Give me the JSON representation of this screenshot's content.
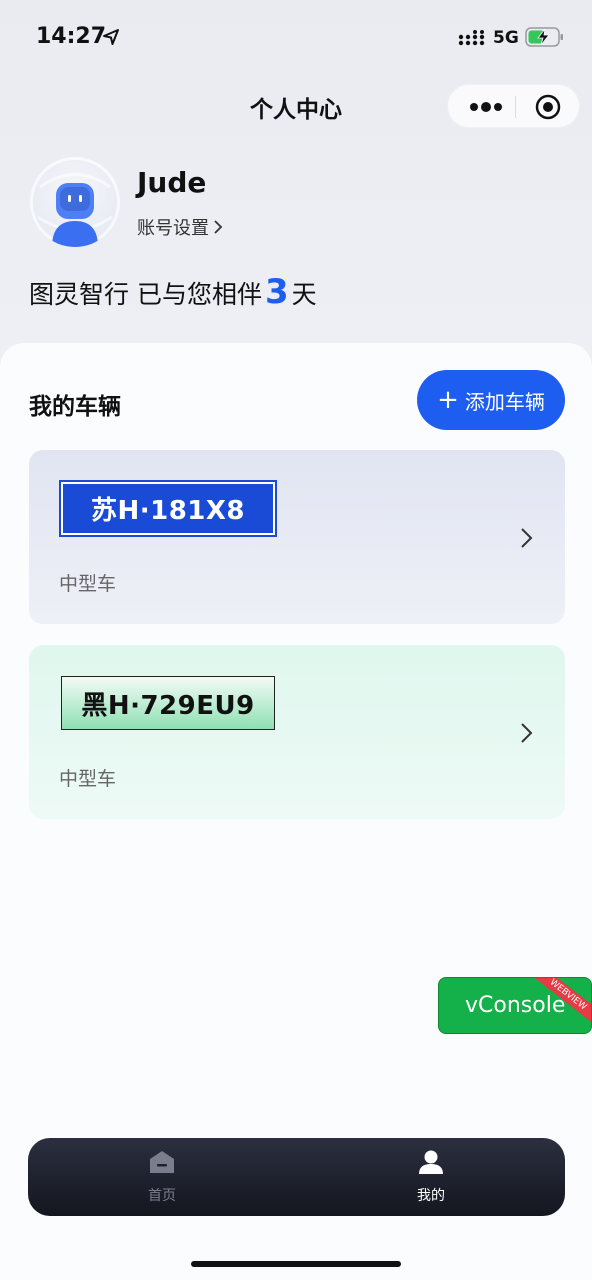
{
  "status_bar": {
    "time": "14:27",
    "network": "5G"
  },
  "nav": {
    "title": "个人中心"
  },
  "profile": {
    "username": "Jude",
    "account_settings": "账号设置",
    "companion_prefix": "图灵智行 已与您相伴",
    "companion_days": "3",
    "companion_suffix": "天"
  },
  "vehicles_section": {
    "title": "我的车辆",
    "add_button": "添加车辆",
    "vehicles": [
      {
        "plate": "苏H·181X8",
        "type": "中型车",
        "plate_color": "#1a4bd6"
      },
      {
        "plate": "黑H·729EU9",
        "type": "中型车",
        "plate_color": "#8fe0b3"
      }
    ]
  },
  "vconsole": {
    "label": "vConsole",
    "ribbon": "WEBVIEW"
  },
  "tabbar": {
    "tabs": [
      {
        "label": "首页",
        "icon": "home-icon",
        "active": false
      },
      {
        "label": "我的",
        "icon": "user-icon",
        "active": true
      }
    ]
  },
  "colors": {
    "accent": "#1d5ef0",
    "vconsole": "#14b04a",
    "tabbar": "#1b1e2a"
  }
}
